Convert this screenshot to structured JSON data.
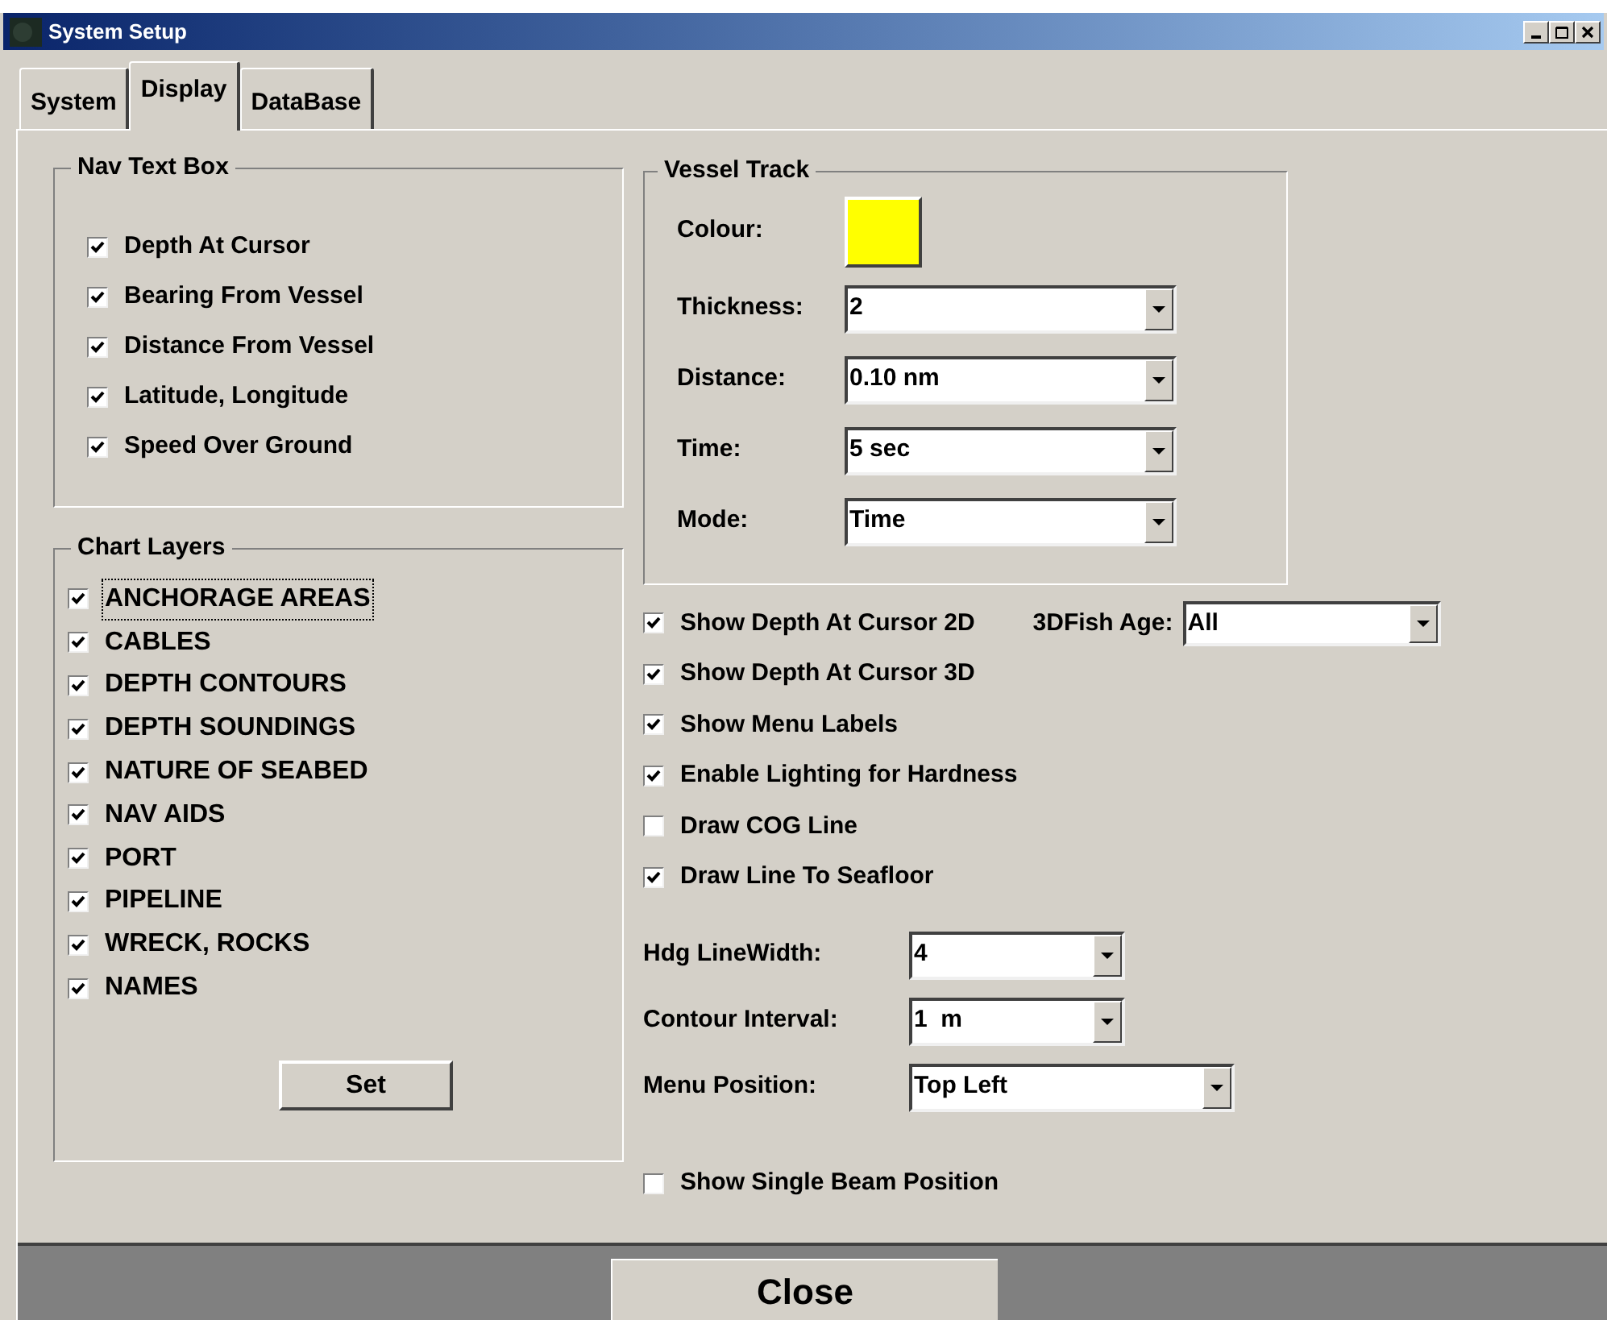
{
  "window": {
    "title": "System Setup"
  },
  "tabs": [
    {
      "label": "System",
      "selected": false
    },
    {
      "label": "Display",
      "selected": true
    },
    {
      "label": "DataBase",
      "selected": false
    }
  ],
  "nav_text_box": {
    "title": "Nav Text Box",
    "items": [
      {
        "label": "Depth At Cursor",
        "checked": true
      },
      {
        "label": "Bearing From Vessel",
        "checked": true
      },
      {
        "label": "Distance From Vessel",
        "checked": true
      },
      {
        "label": "Latitude, Longitude",
        "checked": true
      },
      {
        "label": "Speed Over Ground",
        "checked": true
      }
    ]
  },
  "chart_layers": {
    "title": "Chart Layers",
    "items": [
      {
        "label": "ANCHORAGE AREAS",
        "checked": true,
        "focused": true
      },
      {
        "label": "CABLES",
        "checked": true,
        "focused": false
      },
      {
        "label": "DEPTH CONTOURS",
        "checked": true,
        "focused": false
      },
      {
        "label": "DEPTH SOUNDINGS",
        "checked": true,
        "focused": false
      },
      {
        "label": "NATURE OF SEABED",
        "checked": true,
        "focused": false
      },
      {
        "label": "NAV AIDS",
        "checked": true,
        "focused": false
      },
      {
        "label": "PORT",
        "checked": true,
        "focused": false
      },
      {
        "label": "PIPELINE",
        "checked": true,
        "focused": false
      },
      {
        "label": "WRECK, ROCKS",
        "checked": true,
        "focused": false
      },
      {
        "label": "NAMES",
        "checked": true,
        "focused": false
      }
    ],
    "set_button": "Set"
  },
  "vessel_track": {
    "title": "Vessel Track",
    "colour": {
      "label": "Colour:",
      "color": "#ffff00"
    },
    "dropdowns": [
      {
        "label": "Thickness:",
        "value": "2"
      },
      {
        "label": "Distance:",
        "value": "0.10 nm"
      },
      {
        "label": "Time:",
        "value": "5 sec"
      },
      {
        "label": "Mode:",
        "value": "Time"
      }
    ]
  },
  "fish_age": {
    "label": "3DFish Age:",
    "value": "All"
  },
  "options": [
    {
      "label": "Show Depth At Cursor 2D",
      "checked": true
    },
    {
      "label": "Show Depth At Cursor 3D",
      "checked": true
    },
    {
      "label": "Show Menu Labels",
      "checked": true
    },
    {
      "label": "Enable Lighting for Hardness",
      "checked": true
    },
    {
      "label": "Draw COG Line",
      "checked": false
    },
    {
      "label": "Draw Line To Seafloor",
      "checked": true
    }
  ],
  "settings": [
    {
      "label": "Hdg LineWidth:",
      "value": "4"
    },
    {
      "label": "Contour Interval:",
      "value": "1  m"
    },
    {
      "label": "Menu Position:",
      "value": "Top Left"
    }
  ],
  "single_beam": {
    "label": "Show Single Beam Position",
    "checked": false
  },
  "close_button": "Close"
}
